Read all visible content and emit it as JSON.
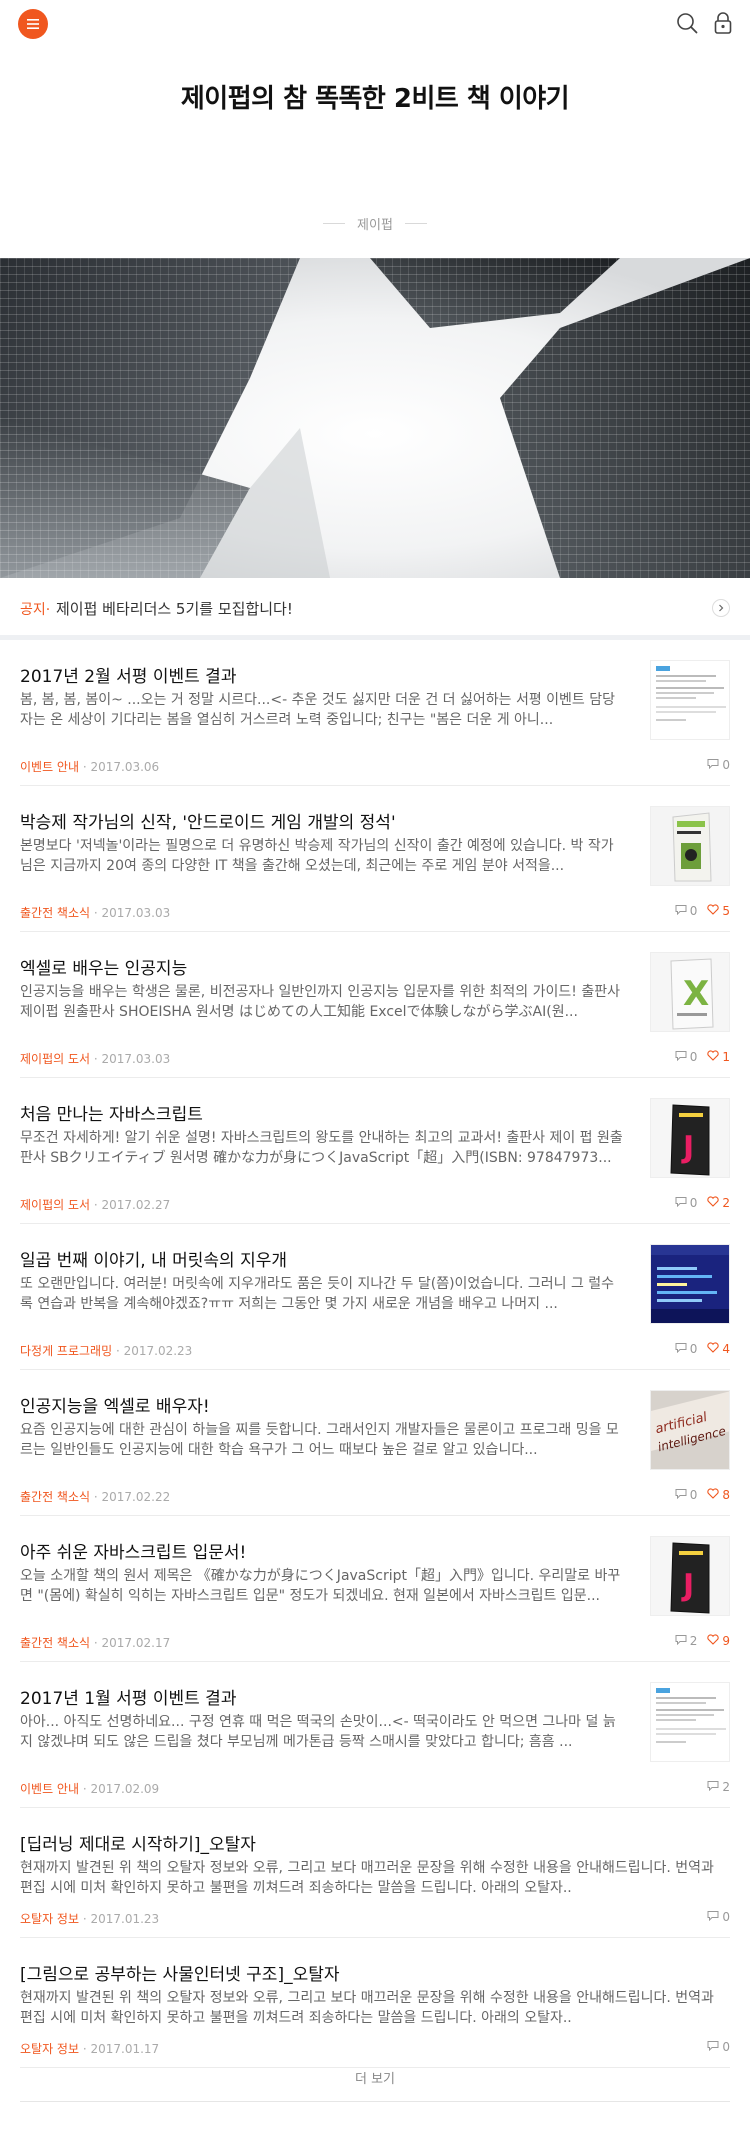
{
  "blog": {
    "title": "제이펍의 참 똑똑한 2비트 책 이야기",
    "author": "제이펍"
  },
  "notice": {
    "label": "공지",
    "text": "제이펍 베타리더스 5기를 모집합니다!"
  },
  "colors": {
    "accent": "#f0571f",
    "text": "#333333",
    "muted": "#999999"
  },
  "icons": {
    "menu": "menu-icon",
    "search": "search-icon",
    "lock": "lock-icon",
    "comment": "comment-icon",
    "heart": "heart-icon",
    "chevron": "chevron-right-icon"
  },
  "posts": [
    {
      "title": "2017년 2월 서평 이벤트 결과",
      "excerpt": "봄, 봄, 봄, 봄이~ ...오는 거 정말 시르다...<- 추운 것도 싫지만 더운 건 더 싫어하는 서평 이벤트 담당자는 온 세상이 기다리는 봄을 열심히 거스르려 노력 중입니다; 친구는 \"봄은 더운 게 아니...",
      "category": "이벤트 안내",
      "date": "2017.03.06",
      "comments": "0",
      "likes": null,
      "thumb": "screenshot"
    },
    {
      "title": "박승제 작가님의 신작, '안드로이드 게임 개발의 정석'",
      "excerpt": "본명보다 '저넥놀'이라는 필명으로 더 유명하신 박승제 작가님의 신작이 출간 예정에 있습니다. 박 작가님은 지금까지 20여 종의 다양한 IT 책을 출간해 오셨는데, 최근에는 주로 게임 분야 서적을...",
      "category": "출간전 책소식",
      "date": "2017.03.03",
      "comments": "0",
      "likes": "5",
      "thumb": "book-green"
    },
    {
      "title": "엑셀로 배우는 인공지능",
      "excerpt": "인공지능을 배우는 학생은 물론, 비전공자나 일반인까지 인공지능 입문자를 위한 최적의 가이드! 출판사 제이펍 원출판사 SHOEISHA 원서명 はじめての人工知能 Excelで体験しながら学ぶAI(원...",
      "category": "제이펍의 도서",
      "date": "2017.03.03",
      "comments": "0",
      "likes": "1",
      "thumb": "book-excel"
    },
    {
      "title": "처음 만나는 자바스크립트",
      "excerpt": "무조건 자세하게! 알기 쉬운 설명! 자바스크립트의 왕도를 안내하는 최고의 교과서! 출판사 제이 펍 원출판사 SBクリエイティブ 원서명 確かな力が身につくJavaScript「超」入門(ISBN: 97847973...",
      "category": "제이펍의 도서",
      "date": "2017.02.27",
      "comments": "0",
      "likes": "2",
      "thumb": "book-js"
    },
    {
      "title": "일곱 번째 이야기, 내 머릿속의 지우개",
      "excerpt": "또 오랜만입니다. 여러분! 머릿속에 지우개라도 품은 듯이 지나간 두 달(쯤)이었습니다. 그러니 그 럴수록 연습과 반복을 계속해야겠죠?ㅠㅠ 저희는 그동안 몇 가지 새로운 개념을 배우고 나머지 ...",
      "category": "다정게 프로그래밍",
      "date": "2017.02.23",
      "comments": "0",
      "likes": "4",
      "thumb": "blue-screen"
    },
    {
      "title": "인공지능을 엑셀로 배우자!",
      "excerpt": "요즘 인공지능에 대한 관심이 하늘을 찌를 듯합니다. 그래서인지 개발자들은 물론이고 프로그래 밍을 모르는 일반인들도 인공지능에 대한 학습 욕구가 그 어느 때보다 높은 걸로 알고 있습니다...",
      "category": "출간전 책소식",
      "date": "2017.02.22",
      "comments": "0",
      "likes": "8",
      "thumb": "ai-text"
    },
    {
      "title": "아주 쉬운 자바스크립트 입문서!",
      "excerpt": "오늘 소개할 책의 원서 제목은 《確かな力が身につくJavaScript「超」入門》입니다. 우리말로 바꾸면 \"(몸에) 확실히 익히는 자바스크립트 입문\" 정도가 되겠네요. 현재 일본에서 자바스크립트 입문...",
      "category": "출간전 책소식",
      "date": "2017.02.17",
      "comments": "2",
      "likes": "9",
      "thumb": "book-js"
    },
    {
      "title": "2017년 1월 서평 이벤트 결과",
      "excerpt": "아아... 아직도 선명하네요... 구정 연휴 때 먹은 떡국의 손맛이...<- 떡국이라도 안 먹으면 그나마 덜 늙지 않겠냐며 되도 않은 드립을 쳤다 부모님께 메가톤급 등짝 스매시를 맞았다고 합니다; 흠흠 ...",
      "category": "이벤트 안내",
      "date": "2017.02.09",
      "comments": "2",
      "likes": null,
      "thumb": "screenshot"
    },
    {
      "title": "[딥러닝 제대로 시작하기]_오탈자",
      "excerpt": "현재까지 발견된 위 책의 오탈자 정보와 오류, 그리고 보다 매끄러운 문장을 위해 수정한 내용을 안내해드립니다. 번역과 편집 시에 미처 확인하지 못하고 불편을 끼쳐드려 죄송하다는 말씀을 드립니다. 아래의 오탈자..",
      "category": "오탈자 정보",
      "date": "2017.01.23",
      "comments": "0",
      "likes": null,
      "thumb": null
    },
    {
      "title": "[그림으로 공부하는 사물인터넷 구조]_오탈자",
      "excerpt": "현재까지 발견된 위 책의 오탈자 정보와 오류, 그리고 보다 매끄러운 문장을 위해 수정한 내용을 안내해드립니다. 번역과 편집 시에 미처 확인하지 못하고 불편을 끼쳐드려 죄송하다는 말씀을 드립니다. 아래의 오탈자..",
      "category": "오탈자 정보",
      "date": "2017.01.17",
      "comments": "0",
      "likes": null,
      "thumb": null
    }
  ],
  "more_label": "더 보기"
}
